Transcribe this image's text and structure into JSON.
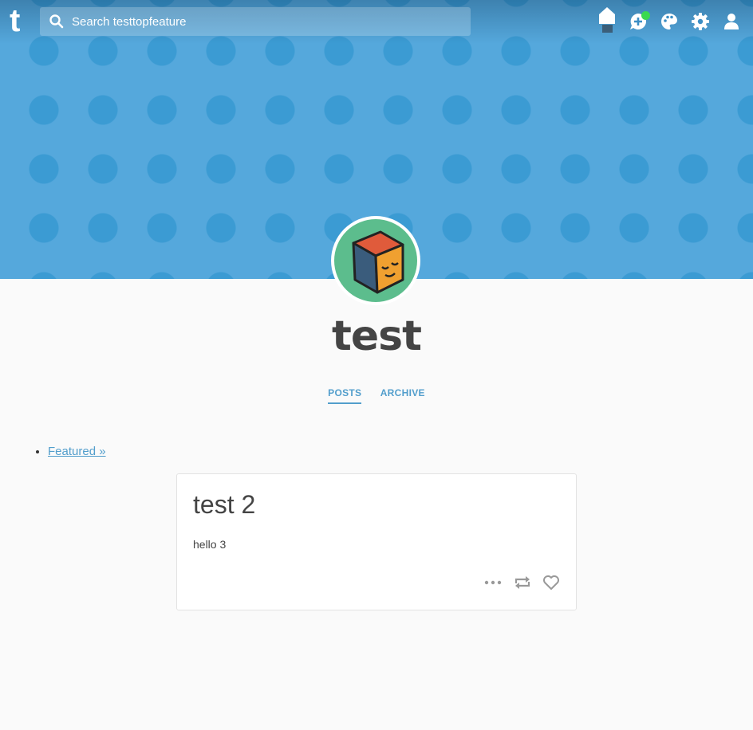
{
  "topbar": {
    "logo": "t",
    "search_placeholder": "Search testtopfeature",
    "icons": [
      "home-icon",
      "new-post-icon",
      "palette-icon",
      "gear-icon",
      "account-icon"
    ],
    "notification_color": "#3ad94f"
  },
  "header": {
    "background_color": "#55a8dc",
    "pattern_color": "#3b9bd3"
  },
  "blog": {
    "title": "test",
    "tabs": [
      {
        "label": "POSTS",
        "active": true
      },
      {
        "label": "ARCHIVE",
        "active": false
      }
    ]
  },
  "featured": {
    "link": "Featured »"
  },
  "post": {
    "title": "test 2",
    "body": "hello 3",
    "actions": [
      "more-icon",
      "reblog-icon",
      "like-icon"
    ]
  }
}
